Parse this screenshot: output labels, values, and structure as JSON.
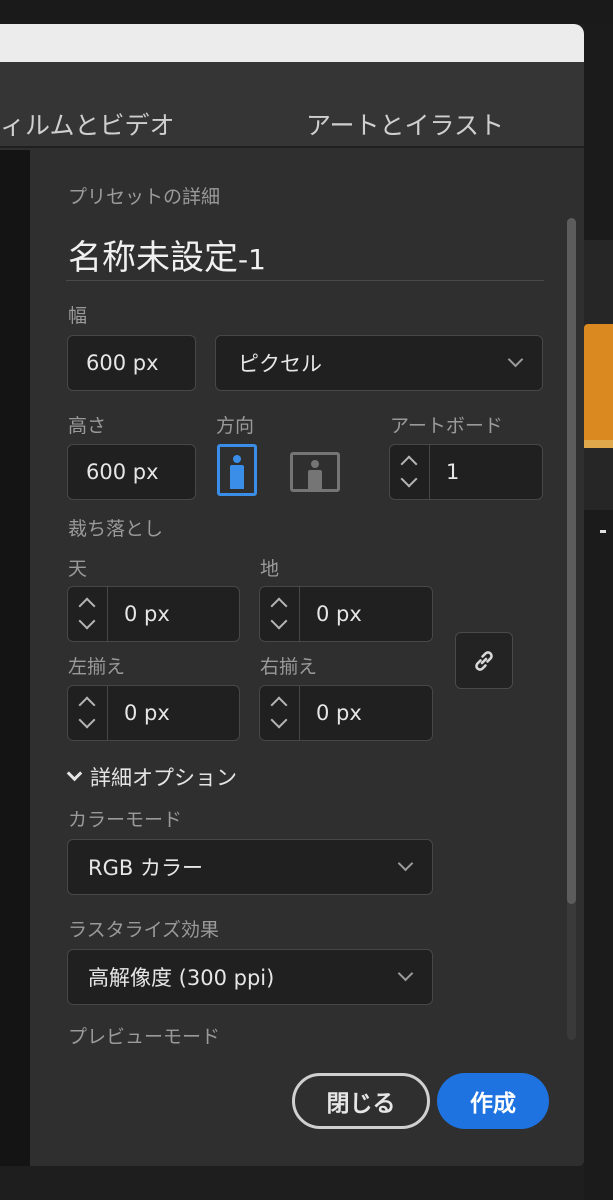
{
  "category_tabs": [
    "ィルムとビデオ",
    "アートとイラスト"
  ],
  "preset": {
    "section_label": "プリセットの詳細",
    "name": "名称未設定",
    "name_suffix": "-1"
  },
  "width": {
    "label": "幅",
    "value": "600 px",
    "unit": "ピクセル"
  },
  "height": {
    "label": "高さ",
    "value": "600 px"
  },
  "orientation": {
    "label": "方向",
    "selected": "portrait"
  },
  "artboard": {
    "label": "アートボード",
    "value": "1"
  },
  "bleed": {
    "label": "裁ち落とし",
    "top": {
      "label": "天",
      "value": "0 px"
    },
    "bottom": {
      "label": "地",
      "value": "0 px"
    },
    "left": {
      "label": "左揃え",
      "value": "0 px"
    },
    "right": {
      "label": "右揃え",
      "value": "0 px"
    }
  },
  "advanced": {
    "toggle_label": "詳細オプション",
    "color_mode": {
      "label": "カラーモード",
      "value": "RGB カラー"
    },
    "raster_effects": {
      "label": "ラスタライズ効果",
      "value": "高解像度 (300 ppi)"
    },
    "preview_mode": {
      "label": "プレビューモード"
    }
  },
  "buttons": {
    "close": "閉じる",
    "create": "作成"
  },
  "colors": {
    "accent": "#1f73e0",
    "orientation_selected": "#3b8ee8",
    "panel_bg": "#2f2f2f"
  }
}
